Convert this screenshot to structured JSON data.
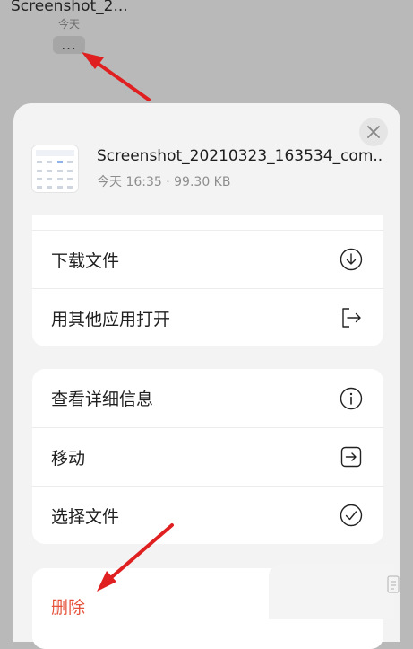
{
  "background": {
    "filename": "Screenshot_2...",
    "date": "今天",
    "more_label": "..."
  },
  "sheet": {
    "file": {
      "name": "Screenshot_20210323_163534_com....",
      "meta": "今天 16:35 · 99.30 KB"
    },
    "group1": [
      {
        "label": "下载文件",
        "icon": "download-icon"
      },
      {
        "label": "用其他应用打开",
        "icon": "open-with-icon"
      }
    ],
    "group2": [
      {
        "label": "查看详细信息",
        "icon": "info-icon"
      },
      {
        "label": "移动",
        "icon": "move-icon"
      },
      {
        "label": "选择文件",
        "icon": "check-icon"
      }
    ],
    "group3": [
      {
        "label": "删除",
        "icon": "",
        "color": "#e5533b"
      }
    ]
  },
  "colors": {
    "overlay": "#b9b9b9",
    "sheet_bg": "#f3f3f3",
    "danger": "#e5533b",
    "annotation_arrow": "#e02020"
  }
}
